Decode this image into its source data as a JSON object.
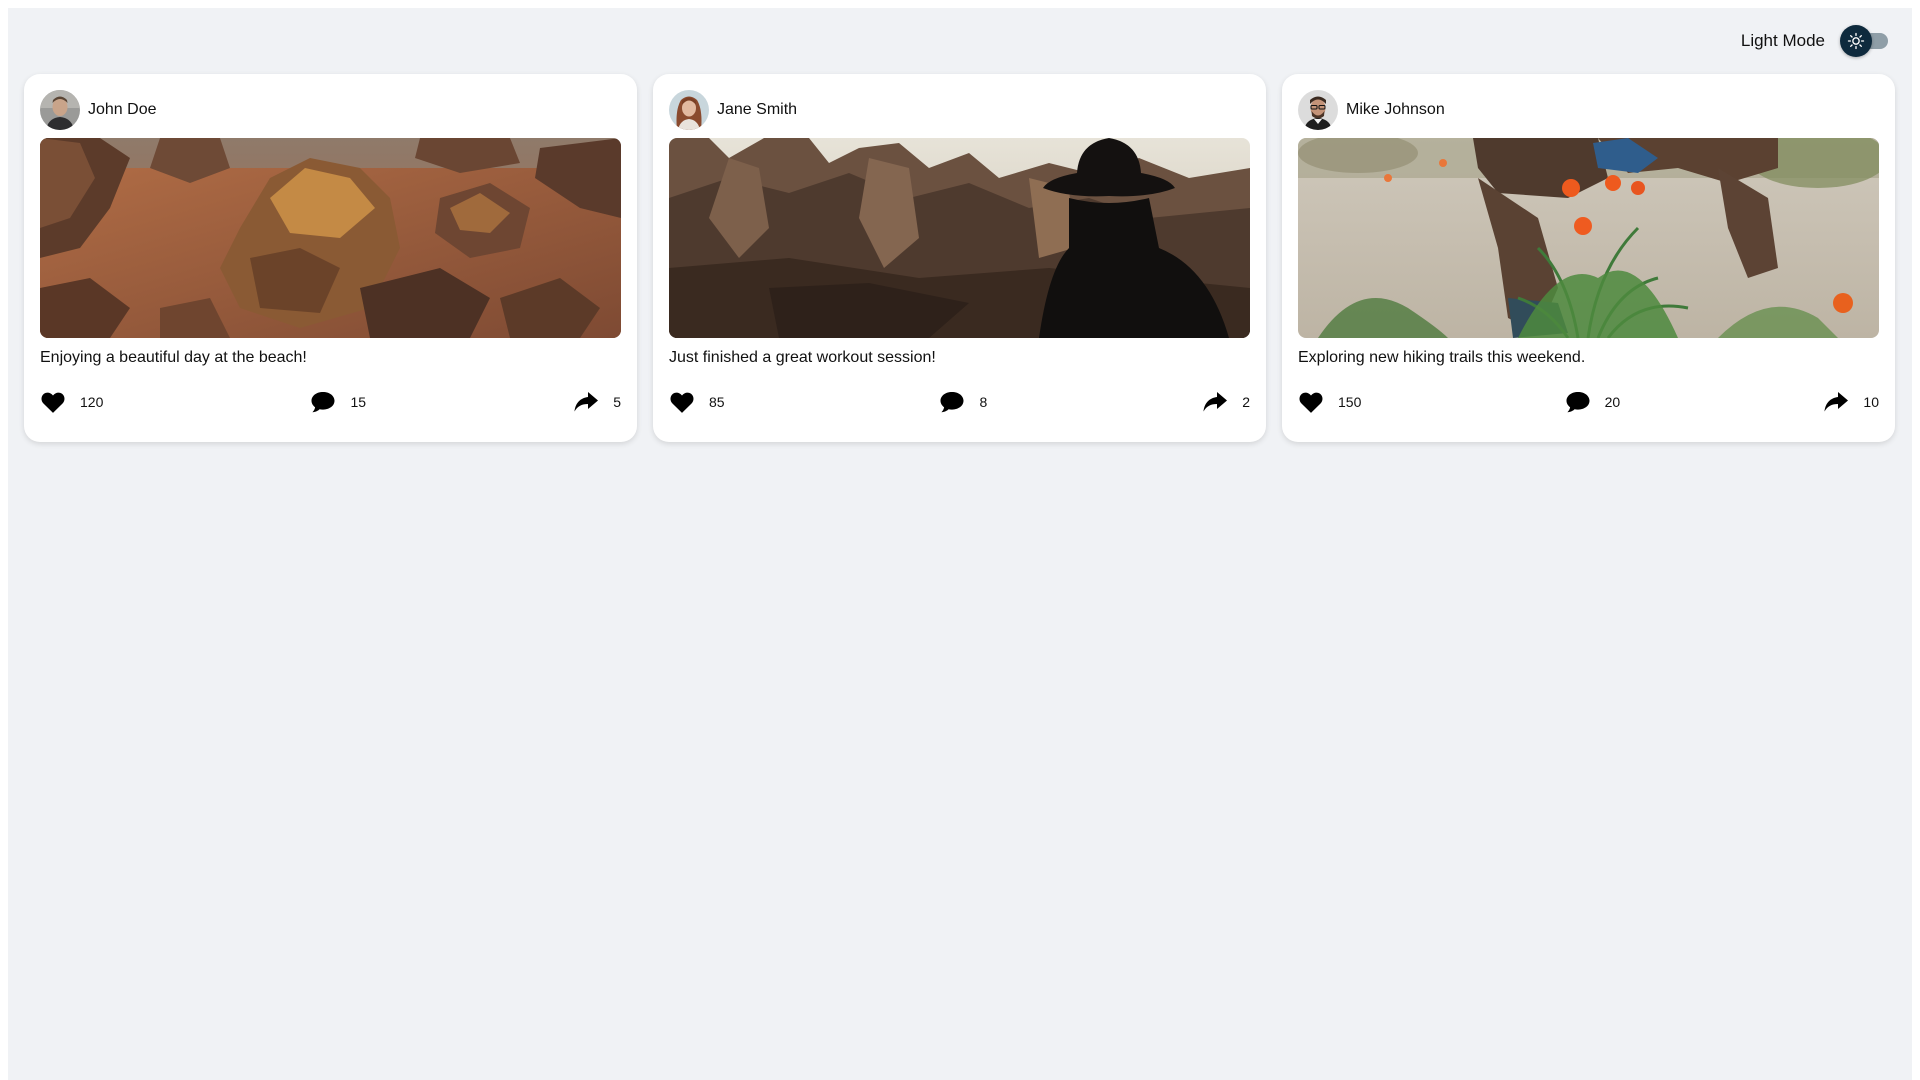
{
  "theme": {
    "label": "Light Mode",
    "icon": "sun-icon",
    "knob_color": "#0e2a3d",
    "track_color": "#8f9ea7"
  },
  "colors": {
    "background": "#f0f2f5",
    "card": "#ffffff",
    "text": "#111111"
  },
  "posts": [
    {
      "user": "John Doe",
      "image": "desert rock formations aerial view",
      "caption": "Enjoying a beautiful day at the beach!",
      "likes": "120",
      "comments": "15",
      "shares": "5"
    },
    {
      "user": "Jane Smith",
      "image": "person in hat silhouetted against desert cliffs",
      "caption": "Just finished a great workout session!",
      "likes": "85",
      "comments": "8",
      "shares": "2"
    },
    {
      "user": "Mike Johnson",
      "image": "person crouching by orange poppies on sandy trail",
      "caption": "Exploring new hiking trails this weekend.",
      "likes": "150",
      "comments": "20",
      "shares": "10"
    }
  ],
  "icons": {
    "like": "heart-icon",
    "comment": "comment-icon",
    "share": "share-icon"
  }
}
